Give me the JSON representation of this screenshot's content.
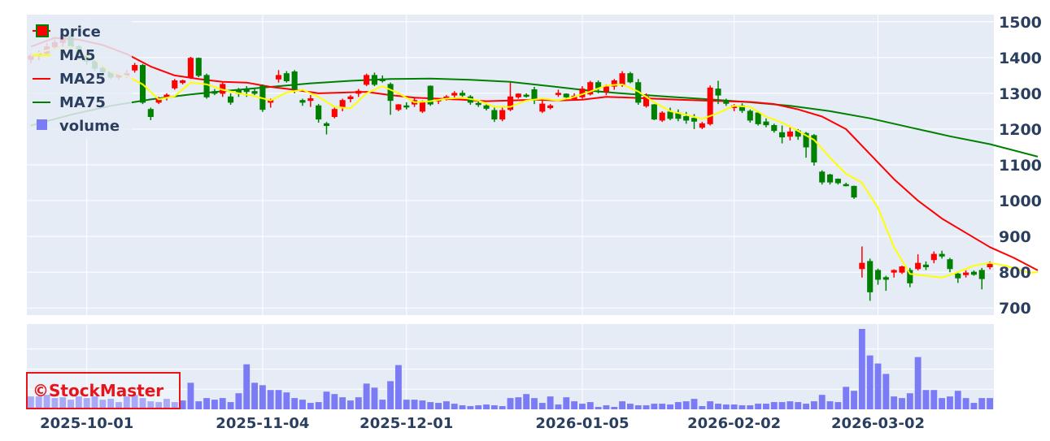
{
  "colors": {
    "plot_bg": "#e5ecf6",
    "grid": "#ffffff",
    "up": "#ff0000",
    "down": "#008000",
    "ma5": "#ffff00",
    "ma25": "#ff0000",
    "ma75": "#008000",
    "volume": "#7b7bf5",
    "text": "#2a3f5f",
    "watermark": "#e8141a"
  },
  "watermark": "©StockMaster",
  "chart_data": {
    "type": "candlestick",
    "price_axis": {
      "range": [
        680,
        1520
      ],
      "ticks": [
        700,
        800,
        900,
        1000,
        1100,
        1200,
        1300,
        1400,
        1500
      ],
      "side": "right"
    },
    "date_axis": {
      "ticks": [
        "2025-10-01",
        "2025-11-04",
        "2025-12-01",
        "2026-01-05",
        "2026-02-02",
        "2026-03-02"
      ],
      "tick_index": [
        7,
        29,
        47,
        69,
        88,
        106
      ]
    },
    "legend": [
      {
        "name": "price",
        "kind": "candle"
      },
      {
        "name": "MA5",
        "kind": "line",
        "color": "#ffff00"
      },
      {
        "name": "MA25",
        "kind": "line",
        "color": "#ff0000"
      },
      {
        "name": "MA75",
        "kind": "line",
        "color": "#008000"
      },
      {
        "name": "volume",
        "kind": "bar",
        "color": "#7b7bf5"
      }
    ],
    "legend_position": "top-left",
    "grid": true,
    "candles": [
      [
        1395,
        1410,
        1385,
        1405
      ],
      [
        1405,
        1420,
        1392,
        1412
      ],
      [
        1412,
        1440,
        1405,
        1430
      ],
      [
        1430,
        1450,
        1422,
        1442
      ],
      [
        1442,
        1470,
        1430,
        1460
      ],
      [
        1460,
        1462,
        1420,
        1430
      ],
      [
        1430,
        1435,
        1395,
        1405
      ],
      [
        1405,
        1410,
        1380,
        1390
      ],
      [
        1390,
        1395,
        1362,
        1370
      ],
      [
        1370,
        1380,
        1350,
        1360
      ],
      [
        1360,
        1362,
        1340,
        1345
      ],
      [
        1345,
        1358,
        1338,
        1352
      ],
      [
        1350,
        1365,
        1342,
        1355
      ],
      [
        1365,
        1385,
        1358,
        1378
      ],
      [
        1378,
        1382,
        1270,
        1275
      ],
      [
        1255,
        1260,
        1225,
        1235
      ],
      [
        1275,
        1290,
        1270,
        1285
      ],
      [
        1290,
        1300,
        1280,
        1295
      ],
      [
        1315,
        1340,
        1310,
        1335
      ],
      [
        1330,
        1338,
        1325,
        1335
      ],
      [
        1345,
        1402,
        1340,
        1398
      ],
      [
        1398,
        1400,
        1345,
        1350
      ],
      [
        1350,
        1355,
        1285,
        1290
      ],
      [
        1305,
        1312,
        1295,
        1300
      ],
      [
        1300,
        1330,
        1290,
        1325
      ],
      [
        1290,
        1300,
        1268,
        1275
      ],
      [
        1310,
        1315,
        1290,
        1300
      ],
      [
        1310,
        1320,
        1290,
        1305
      ],
      [
        1305,
        1312,
        1295,
        1300
      ],
      [
        1320,
        1325,
        1248,
        1255
      ],
      [
        1275,
        1285,
        1260,
        1280
      ],
      [
        1340,
        1365,
        1330,
        1350
      ],
      [
        1355,
        1362,
        1330,
        1335
      ],
      [
        1360,
        1365,
        1300,
        1312
      ],
      [
        1280,
        1285,
        1265,
        1275
      ],
      [
        1280,
        1295,
        1262,
        1285
      ],
      [
        1265,
        1270,
        1218,
        1228
      ],
      [
        1215,
        1220,
        1185,
        1210
      ],
      [
        1235,
        1262,
        1230,
        1255
      ],
      [
        1260,
        1285,
        1250,
        1280
      ],
      [
        1285,
        1295,
        1275,
        1290
      ],
      [
        1300,
        1312,
        1290,
        1306
      ],
      [
        1325,
        1355,
        1320,
        1350
      ],
      [
        1350,
        1358,
        1320,
        1325
      ],
      [
        1340,
        1350,
        1330,
        1335
      ],
      [
        1325,
        1330,
        1240,
        1280
      ],
      [
        1255,
        1270,
        1250,
        1268
      ],
      [
        1265,
        1275,
        1255,
        1262
      ],
      [
        1270,
        1290,
        1262,
        1280
      ],
      [
        1250,
        1280,
        1245,
        1275
      ],
      [
        1320,
        1322,
        1265,
        1270
      ],
      [
        1280,
        1285,
        1270,
        1282
      ],
      [
        1283,
        1295,
        1280,
        1290
      ],
      [
        1295,
        1306,
        1288,
        1300
      ],
      [
        1300,
        1308,
        1290,
        1295
      ],
      [
        1290,
        1295,
        1268,
        1275
      ],
      [
        1272,
        1278,
        1262,
        1270
      ],
      [
        1265,
        1270,
        1252,
        1258
      ],
      [
        1252,
        1262,
        1220,
        1228
      ],
      [
        1228,
        1260,
        1222,
        1252
      ],
      [
        1255,
        1330,
        1250,
        1290
      ],
      [
        1290,
        1300,
        1285,
        1298
      ],
      [
        1295,
        1300,
        1288,
        1292
      ],
      [
        1310,
        1318,
        1270,
        1282
      ],
      [
        1250,
        1280,
        1245,
        1270
      ],
      [
        1260,
        1270,
        1255,
        1265
      ],
      [
        1300,
        1310,
        1290,
        1300
      ],
      [
        1298,
        1300,
        1285,
        1290
      ],
      [
        1285,
        1300,
        1280,
        1292
      ],
      [
        1290,
        1320,
        1285,
        1312
      ],
      [
        1298,
        1335,
        1294,
        1330
      ],
      [
        1330,
        1336,
        1300,
        1315
      ],
      [
        1305,
        1325,
        1295,
        1318
      ],
      [
        1320,
        1340,
        1310,
        1335
      ],
      [
        1325,
        1362,
        1318,
        1355
      ],
      [
        1355,
        1360,
        1328,
        1332
      ],
      [
        1330,
        1340,
        1268,
        1275
      ],
      [
        1265,
        1300,
        1260,
        1290
      ],
      [
        1268,
        1270,
        1225,
        1228
      ],
      [
        1225,
        1250,
        1220,
        1245
      ],
      [
        1248,
        1260,
        1225,
        1230
      ],
      [
        1245,
        1255,
        1222,
        1230
      ],
      [
        1235,
        1248,
        1215,
        1225
      ],
      [
        1230,
        1242,
        1200,
        1222
      ],
      [
        1205,
        1220,
        1200,
        1215
      ],
      [
        1215,
        1322,
        1210,
        1315
      ],
      [
        1312,
        1335,
        1270,
        1295
      ],
      [
        1280,
        1285,
        1265,
        1272
      ],
      [
        1260,
        1270,
        1250,
        1265
      ],
      [
        1265,
        1272,
        1245,
        1252
      ],
      [
        1250,
        1255,
        1218,
        1225
      ],
      [
        1245,
        1250,
        1210,
        1215
      ],
      [
        1220,
        1230,
        1205,
        1212
      ],
      [
        1210,
        1215,
        1190,
        1196
      ],
      [
        1190,
        1210,
        1160,
        1178
      ],
      [
        1180,
        1205,
        1168,
        1192
      ],
      [
        1195,
        1200,
        1170,
        1180
      ],
      [
        1188,
        1192,
        1120,
        1150
      ],
      [
        1182,
        1186,
        1098,
        1108
      ],
      [
        1080,
        1085,
        1045,
        1052
      ],
      [
        1072,
        1075,
        1045,
        1052
      ],
      [
        1060,
        1062,
        1045,
        1050
      ],
      [
        1045,
        1050,
        1040,
        1042
      ],
      [
        1040,
        1042,
        1005,
        1010
      ],
      [
        810,
        872,
        785,
        825
      ],
      [
        830,
        838,
        720,
        745
      ],
      [
        805,
        810,
        765,
        780
      ],
      [
        785,
        790,
        748,
        780
      ],
      [
        800,
        808,
        785,
        805
      ],
      [
        800,
        818,
        795,
        815
      ],
      [
        805,
        812,
        758,
        770
      ],
      [
        810,
        850,
        805,
        825
      ],
      [
        820,
        830,
        806,
        815
      ],
      [
        835,
        858,
        825,
        850
      ],
      [
        850,
        860,
        838,
        845
      ],
      [
        835,
        840,
        800,
        810
      ],
      [
        795,
        802,
        770,
        784
      ],
      [
        793,
        805,
        785,
        798
      ],
      [
        800,
        805,
        790,
        794
      ],
      [
        805,
        812,
        752,
        782
      ],
      [
        815,
        830,
        808,
        824
      ]
    ],
    "ma5": [
      [
        0,
        1405
      ],
      [
        2,
        1420
      ],
      [
        5,
        1430
      ],
      [
        8,
        1395
      ],
      [
        10,
        1360
      ],
      [
        12,
        1348
      ],
      [
        14,
        1325
      ],
      [
        16,
        1283
      ],
      [
        18,
        1292
      ],
      [
        20,
        1330
      ],
      [
        22,
        1325
      ],
      [
        24,
        1310
      ],
      [
        26,
        1300
      ],
      [
        28,
        1292
      ],
      [
        30,
        1280
      ],
      [
        32,
        1302
      ],
      [
        34,
        1310
      ],
      [
        36,
        1290
      ],
      [
        38,
        1262
      ],
      [
        40,
        1258
      ],
      [
        42,
        1300
      ],
      [
        44,
        1320
      ],
      [
        46,
        1300
      ],
      [
        48,
        1275
      ],
      [
        50,
        1278
      ],
      [
        52,
        1285
      ],
      [
        54,
        1288
      ],
      [
        56,
        1280
      ],
      [
        58,
        1262
      ],
      [
        60,
        1262
      ],
      [
        62,
        1280
      ],
      [
        64,
        1285
      ],
      [
        66,
        1280
      ],
      [
        68,
        1290
      ],
      [
        70,
        1305
      ],
      [
        72,
        1322
      ],
      [
        74,
        1325
      ],
      [
        76,
        1305
      ],
      [
        78,
        1275
      ],
      [
        80,
        1250
      ],
      [
        82,
        1240
      ],
      [
        84,
        1228
      ],
      [
        86,
        1245
      ],
      [
        88,
        1265
      ],
      [
        90,
        1262
      ],
      [
        92,
        1235
      ],
      [
        94,
        1218
      ],
      [
        96,
        1195
      ],
      [
        98,
        1170
      ],
      [
        100,
        1120
      ],
      [
        102,
        1075
      ],
      [
        104,
        1050
      ],
      [
        106,
        980
      ],
      [
        108,
        870
      ],
      [
        110,
        795
      ],
      [
        112,
        790
      ],
      [
        114,
        785
      ],
      [
        116,
        800
      ],
      [
        118,
        818
      ],
      [
        120,
        826
      ],
      [
        122,
        818
      ],
      [
        124,
        805
      ],
      [
        125,
        798
      ],
      [
        126,
        800
      ]
    ],
    "ma25": [
      [
        0,
        1430
      ],
      [
        3,
        1455
      ],
      [
        6,
        1450
      ],
      [
        9,
        1435
      ],
      [
        12,
        1410
      ],
      [
        15,
        1375
      ],
      [
        18,
        1350
      ],
      [
        21,
        1340
      ],
      [
        24,
        1332
      ],
      [
        27,
        1330
      ],
      [
        30,
        1318
      ],
      [
        33,
        1310
      ],
      [
        36,
        1300
      ],
      [
        39,
        1302
      ],
      [
        42,
        1304
      ],
      [
        45,
        1295
      ],
      [
        48,
        1288
      ],
      [
        51,
        1285
      ],
      [
        54,
        1282
      ],
      [
        57,
        1278
      ],
      [
        60,
        1280
      ],
      [
        63,
        1282
      ],
      [
        66,
        1280
      ],
      [
        69,
        1282
      ],
      [
        72,
        1290
      ],
      [
        75,
        1288
      ],
      [
        78,
        1285
      ],
      [
        81,
        1282
      ],
      [
        84,
        1280
      ],
      [
        87,
        1278
      ],
      [
        90,
        1276
      ],
      [
        93,
        1270
      ],
      [
        96,
        1255
      ],
      [
        99,
        1235
      ],
      [
        102,
        1200
      ],
      [
        105,
        1130
      ],
      [
        108,
        1060
      ],
      [
        111,
        1000
      ],
      [
        114,
        950
      ],
      [
        117,
        910
      ],
      [
        120,
        870
      ],
      [
        123,
        840
      ],
      [
        126,
        805
      ]
    ],
    "ma75": [
      [
        0,
        1210
      ],
      [
        5,
        1240
      ],
      [
        10,
        1265
      ],
      [
        15,
        1283
      ],
      [
        20,
        1297
      ],
      [
        25,
        1308
      ],
      [
        30,
        1318
      ],
      [
        35,
        1328
      ],
      [
        40,
        1335
      ],
      [
        45,
        1340
      ],
      [
        50,
        1341
      ],
      [
        55,
        1338
      ],
      [
        60,
        1332
      ],
      [
        65,
        1320
      ],
      [
        70,
        1307
      ],
      [
        75,
        1298
      ],
      [
        80,
        1290
      ],
      [
        85,
        1283
      ],
      [
        90,
        1275
      ],
      [
        95,
        1265
      ],
      [
        100,
        1250
      ],
      [
        105,
        1230
      ],
      [
        110,
        1205
      ],
      [
        115,
        1180
      ],
      [
        120,
        1158
      ],
      [
        126,
        1123
      ]
    ],
    "volume": [
      16,
      16,
      18,
      14,
      15,
      12,
      16,
      14,
      16,
      12,
      13,
      9,
      16,
      18,
      14,
      10,
      9,
      13,
      9,
      11,
      33,
      10,
      14,
      12,
      14,
      9,
      20,
      56,
      33,
      30,
      24,
      24,
      21,
      14,
      12,
      8,
      9,
      22,
      19,
      15,
      11,
      15,
      32,
      27,
      12,
      35,
      55,
      12,
      12,
      11,
      9,
      8,
      10,
      7,
      5,
      4,
      5,
      6,
      5,
      4,
      14,
      15,
      19,
      14,
      8,
      16,
      6,
      15,
      10,
      7,
      9,
      3,
      5,
      3,
      10,
      7,
      5,
      5,
      7,
      7,
      6,
      9,
      10,
      13,
      4,
      10,
      7,
      6,
      6,
      5,
      5,
      7,
      7,
      9,
      9,
      10,
      9,
      7,
      10,
      18,
      10,
      9,
      28,
      23,
      100,
      67,
      57,
      44,
      16,
      14,
      20,
      65,
      24,
      24,
      14,
      16,
      23,
      14,
      8,
      14,
      14
    ],
    "volume_range": [
      0,
      100
    ]
  }
}
